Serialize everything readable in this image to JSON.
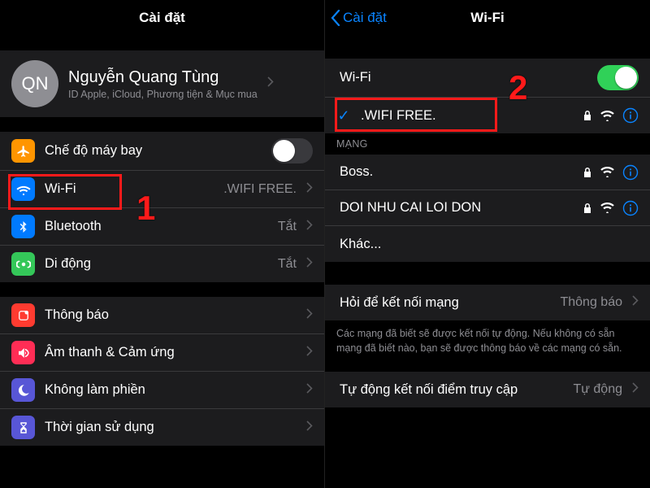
{
  "annotations": {
    "one": "1",
    "two": "2"
  },
  "left": {
    "title": "Cài đặt",
    "profile": {
      "initials": "QN",
      "name": "Nguyễn Quang Tùng",
      "sub": "ID Apple, iCloud, Phương tiện & Mục mua"
    },
    "airplane": "Chế độ máy bay",
    "wifi": {
      "label": "Wi-Fi",
      "detail": ".WIFI FREE."
    },
    "bluetooth": {
      "label": "Bluetooth",
      "detail": "Tắt"
    },
    "cellular": {
      "label": "Di động",
      "detail": "Tắt"
    },
    "notifications": "Thông báo",
    "sounds": "Âm thanh & Cảm ứng",
    "dnd": "Không làm phiền",
    "screentime": "Thời gian sử dụng"
  },
  "right": {
    "back": "Cài đặt",
    "title": "Wi-Fi",
    "wifi_toggle": "Wi-Fi",
    "connected": ".WIFI FREE.",
    "section_networks": "MẠNG",
    "nets": [
      {
        "name": "Boss."
      },
      {
        "name": "DOI NHU CAI LOI DON"
      }
    ],
    "other": "Khác...",
    "ask": {
      "label": "Hỏi để kết nối mạng",
      "detail": "Thông báo"
    },
    "ask_footer": "Các mạng đã biết sẽ được kết nối tự động. Nếu không có sẵn mạng đã biết nào, bạn sẽ được thông báo về các mạng có sẵn.",
    "auto": {
      "label": "Tự động kết nối điểm truy cập",
      "detail": "Tự động"
    }
  }
}
